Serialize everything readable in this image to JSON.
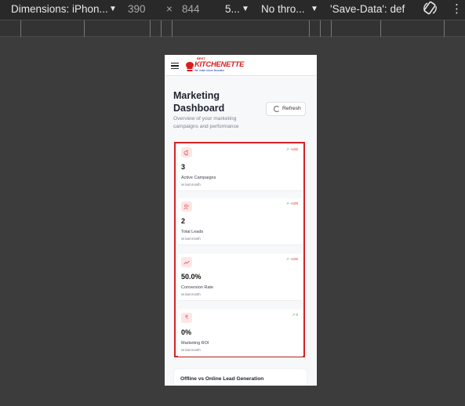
{
  "toolbar": {
    "dimensions_label": "Dimensions: iPhon...",
    "width": "390",
    "times": "×",
    "height": "844",
    "zoom": "5...",
    "throttle": "No thro...",
    "save_data": "'Save-Data': def"
  },
  "header": {
    "logo_best": "BEST",
    "logo_brand": "KITCHENETTE",
    "logo_tagline": "We make future Beautiful"
  },
  "page": {
    "title": "Marketing Dashboard",
    "subtitle": "Overview of your marketing campaigns and performance",
    "refresh_label": "Refresh"
  },
  "stats": [
    {
      "icon": "megaphone-icon",
      "trend": "+100",
      "value": "3",
      "label": "Active Campaigns",
      "sub": "vs last month"
    },
    {
      "icon": "users-icon",
      "trend": "+100",
      "value": "2",
      "label": "Total Leads",
      "sub": "vs last month"
    },
    {
      "icon": "trending-up-icon",
      "trend": "+100",
      "value": "50.0%",
      "label": "Conversion Rate",
      "sub": "vs last month"
    },
    {
      "icon": "rupee-icon",
      "trend": "0",
      "value": "0%",
      "label": "Marketing ROI",
      "sub": "vs last month"
    }
  ],
  "section": {
    "title": "Offline vs Online Lead Generation"
  },
  "colors": {
    "accent": "#d42424",
    "trend_up": "#2a9a4a"
  }
}
